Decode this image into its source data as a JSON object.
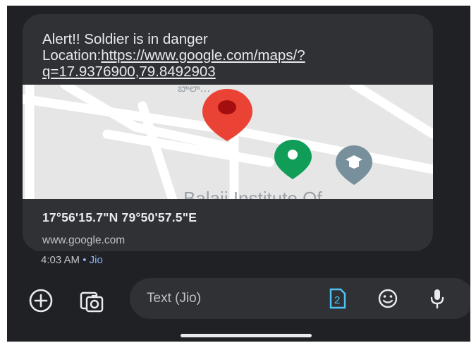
{
  "message": {
    "text_line": "Alert!! Soldier is in danger",
    "location_prefix": "Location:",
    "location_link": "https://www.google.com/maps/?q=17.9376900,79.8492903"
  },
  "map_preview": {
    "place_label_top": "బాలా...",
    "place_label_bottom": "Balaji Institute Of"
  },
  "link_card": {
    "coordinates": "17°56'15.7\"N 79°50'57.5\"E",
    "domain": "www.google.com"
  },
  "meta": {
    "time": "4:03 AM",
    "separator": "•",
    "carrier": "Jio"
  },
  "composer": {
    "placeholder": "Text (Jio)",
    "sim_badge": "2"
  },
  "icons": [
    "add-icon",
    "gallery-icon",
    "sim-icon",
    "emoji-icon",
    "mic-icon"
  ],
  "colors": {
    "background": "#202124",
    "bubble": "#303134",
    "accent": "#8ab4f8",
    "sim_icon": "#4fc3f7",
    "pin_red": "#ea4335",
    "pin_green": "#0f9d58"
  }
}
